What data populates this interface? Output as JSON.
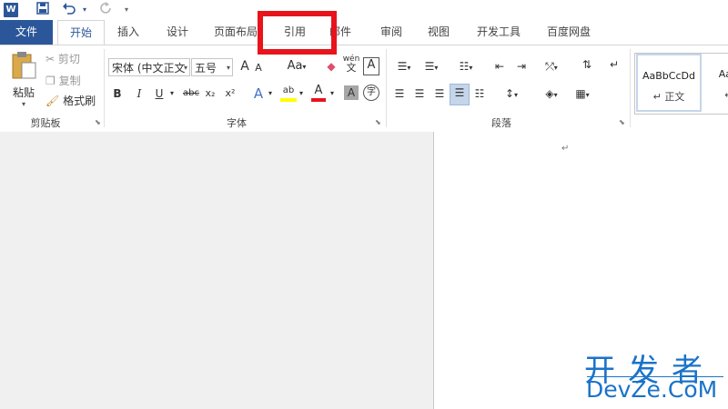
{
  "qat": {
    "app_logo": "W",
    "save_icon": "save-icon",
    "undo_icon": "undo-icon",
    "redo_icon": "redo-icon",
    "customize_icon": "customize-qat-icon"
  },
  "tabs": {
    "file": "文件",
    "home": "开始",
    "insert": "插入",
    "design": "设计",
    "layout": "页面布局",
    "references": "引用",
    "mailings": "邮件",
    "review": "审阅",
    "view": "视图",
    "developer": "开发工具",
    "baidu": "百度网盘"
  },
  "clipboard": {
    "paste": "粘贴",
    "cut": "剪切",
    "copy": "复制",
    "format_painter": "格式刷",
    "group_label": "剪贴板"
  },
  "font": {
    "font_name": "宋体 (中文正文",
    "font_size": "五号",
    "grow": "A",
    "shrink": "A",
    "case": "Aa",
    "phonetic": "wén",
    "border_char": "A",
    "bold": "B",
    "italic": "I",
    "underline": "U",
    "strikethrough": "abc",
    "subscript": "x₂",
    "superscript": "x²",
    "text_effects": "A",
    "highlight": "ab",
    "font_color": "A",
    "char_shading": "A",
    "enclose": "字",
    "group_label": "字体"
  },
  "paragraph": {
    "group_label": "段落"
  },
  "styles": {
    "normal_sample": "AaBbCcDd",
    "normal_name": "↵ 正文",
    "nospacing_sample": "AaBbC",
    "nospacing_name": "↵ 无"
  },
  "document": {
    "paragraph_mark": "↵"
  },
  "watermark": {
    "cn": "开发者",
    "en": "DevZe.CoM"
  },
  "colors": {
    "accent": "#2b579a",
    "highlight_box": "#e8131b",
    "watermark": "#1a73c8"
  }
}
